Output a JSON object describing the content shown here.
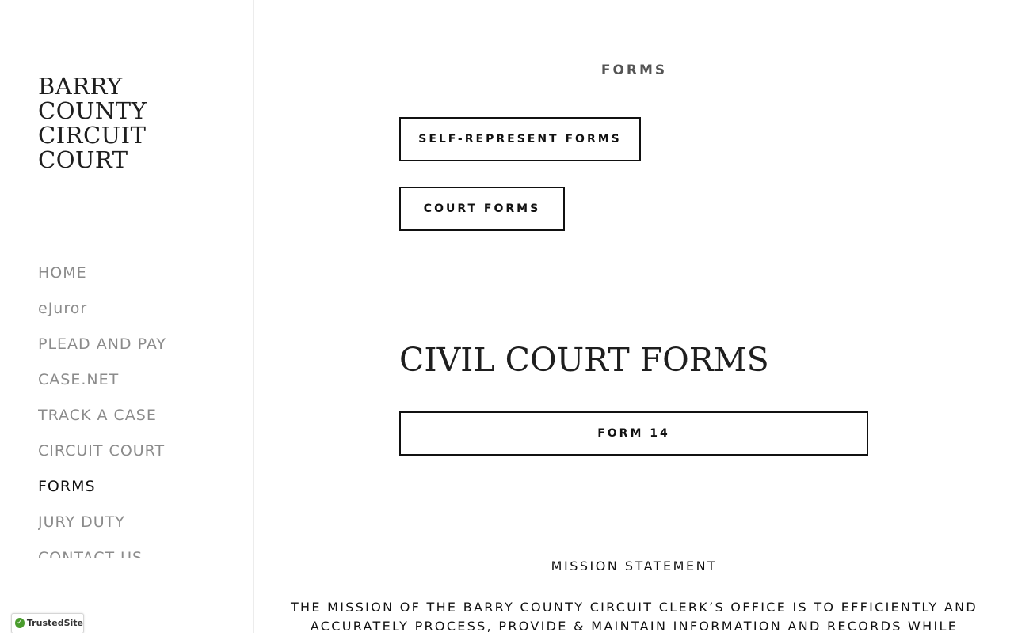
{
  "sidebar": {
    "site_title_lines": [
      "BARRY",
      "COUNTY",
      "CIRCUIT",
      "COURT"
    ],
    "nav_items": [
      {
        "label": "HOME",
        "active": false
      },
      {
        "label": "eJuror",
        "active": false
      },
      {
        "label": "PLEAD AND PAY",
        "active": false
      },
      {
        "label": "CASE.NET",
        "active": false
      },
      {
        "label": "TRACK A CASE",
        "active": false
      },
      {
        "label": "CIRCUIT COURT",
        "active": false
      },
      {
        "label": "FORMS",
        "active": true
      },
      {
        "label": "JURY DUTY",
        "active": false
      },
      {
        "label": "CONTACT US",
        "active": false
      }
    ],
    "trusted_badge": "TrustedSite"
  },
  "main": {
    "section_label": "FORMS",
    "buttons": {
      "self_represent": "SELF-REPRESENT FORMS",
      "court_forms": "COURT FORMS",
      "form14": "FORM 14"
    },
    "civil_heading": "CIVIL COURT FORMS",
    "mission_title": "MISSION STATEMENT",
    "mission_text": "THE MISSION OF THE BARRY COUNTY CIRCUIT CLERK’S OFFICE IS TO EFFICIENTLY AND ACCURATELY PROCESS, PROVIDE & MAINTAIN INFORMATION AND RECORDS WHILE"
  },
  "colors": {
    "accent": "#111111",
    "nav_inactive": "#8b8b8b",
    "badge_check": "#4a9c2d"
  }
}
